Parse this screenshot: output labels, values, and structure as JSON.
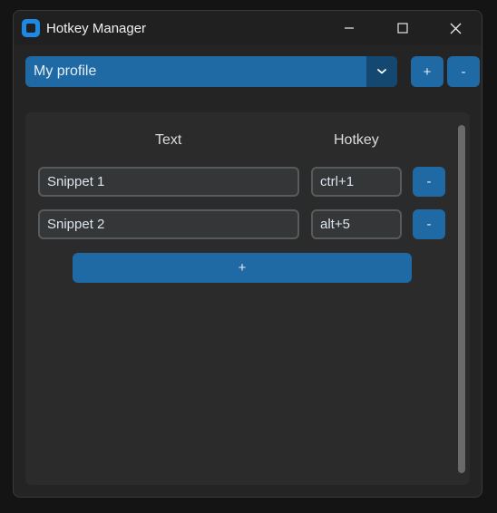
{
  "window": {
    "title": "Hotkey Manager",
    "icons": {
      "app": "app-icon",
      "minimize": "minimize-icon",
      "maximize": "maximize-icon",
      "close": "close-icon"
    }
  },
  "profile": {
    "selected": "My profile",
    "dropdown_icon": "chevron-down-icon",
    "add_label": "+",
    "remove_label": "-"
  },
  "table": {
    "headers": {
      "text": "Text",
      "hotkey": "Hotkey"
    },
    "rows": [
      {
        "text": "Snippet 1",
        "hotkey": "ctrl+1",
        "remove_label": "-"
      },
      {
        "text": "Snippet 2",
        "hotkey": "alt+5",
        "remove_label": "-"
      }
    ],
    "add_label": "+"
  },
  "colors": {
    "accent": "#1f6aa5",
    "accent_dark": "#144870",
    "window_bg": "#242424",
    "panel_bg": "#2b2b2b",
    "field_bg": "#343638",
    "field_border": "#565b5e"
  }
}
